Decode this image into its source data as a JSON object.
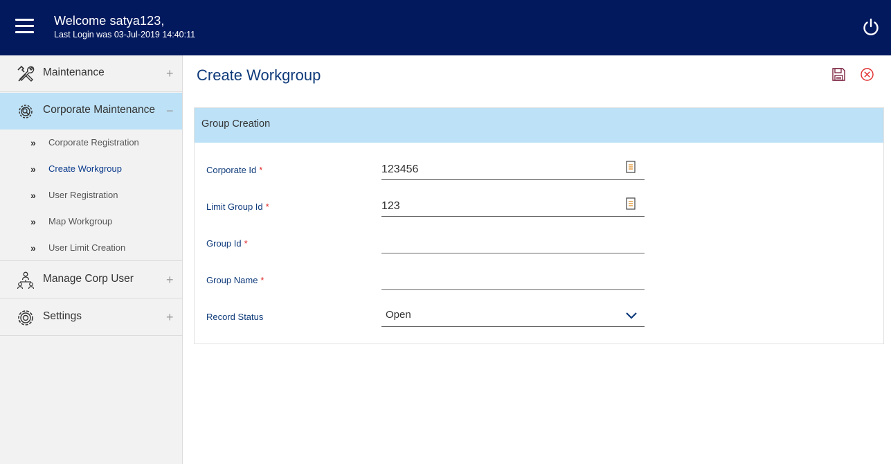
{
  "header": {
    "welcome": "Welcome satya123,",
    "last_login": "Last Login was 03-Jul-2019 14:40:11",
    "menu_icon": "hamburger-icon",
    "logout_icon": "power-icon"
  },
  "sidebar": {
    "menus": [
      {
        "label": "Maintenance",
        "icon": "tools-icon",
        "toggle": "+"
      },
      {
        "label": "Corporate Maintenance",
        "icon": "gear-search-icon",
        "toggle": "−"
      },
      {
        "label": "Manage Corp User",
        "icon": "users-hierarchy-icon",
        "toggle": "+"
      },
      {
        "label": "Settings",
        "icon": "gear-icon",
        "toggle": "+"
      }
    ],
    "submenu_chevron": "»",
    "submenu": [
      {
        "label": "Corporate Registration"
      },
      {
        "label": "Create Workgroup"
      },
      {
        "label": "User Registration"
      },
      {
        "label": "Map Workgroup"
      },
      {
        "label": "User Limit Creation"
      }
    ]
  },
  "page": {
    "title": "Create Workgroup",
    "save_icon": "save-icon",
    "close_icon": "close-circle-icon"
  },
  "form": {
    "section_title": "Group Creation",
    "required_mark": "*",
    "fields": {
      "corporate_id": {
        "label": "Corporate Id",
        "value": "123456"
      },
      "limit_group_id": {
        "label": "Limit Group Id",
        "value": "123"
      },
      "group_id": {
        "label": "Group Id",
        "value": ""
      },
      "group_name": {
        "label": "Group Name",
        "value": ""
      },
      "record_status": {
        "label": "Record Status",
        "value": "Open"
      }
    }
  },
  "colors": {
    "header_bg": "#03195e",
    "active_bg": "#bde1f6",
    "title": "#0e3a7a",
    "required": "#e02b2b",
    "close": "#e02b2b",
    "save": "#7a1f3d"
  }
}
